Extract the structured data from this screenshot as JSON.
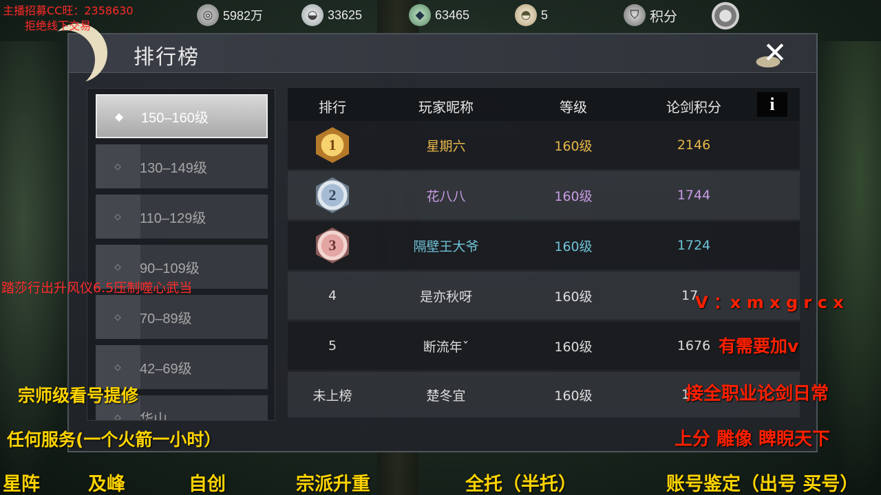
{
  "overlay": {
    "top_left_line1": "主播招募CC旺：2358630",
    "top_left_line2": "拒绝线下交易",
    "mid_left_red": "踏莎行出升风仪6.5压制噬心武当",
    "left_yellow_1": "宗师级看号提修",
    "left_yellow_2": "任何服务(一个火箭一小时）",
    "right_contact": "V ：x m x g r c x",
    "right_line_1": "有需要加v",
    "right_line_2": "接全职业论剑日常",
    "right_line_3": "上分   雕像  睥睨天下",
    "bottom_menu": [
      "星阵",
      "及峰",
      "自创",
      "宗派升重",
      "全托（半托）",
      "账号鉴定（出号 买号）"
    ]
  },
  "resources": [
    {
      "icon": "coin-icon",
      "value": "5982万"
    },
    {
      "icon": "silver-ingot-icon",
      "value": "33625"
    },
    {
      "icon": "jade-icon",
      "value": "63465"
    },
    {
      "icon": "gold-ingot-icon",
      "value": "5"
    },
    {
      "icon": "score-badge-icon",
      "value": "积分"
    }
  ],
  "panel": {
    "title": "排行榜",
    "close_glyph": "✕"
  },
  "tiers": [
    {
      "label": "150–160级",
      "active": true
    },
    {
      "label": "130–149级",
      "active": false
    },
    {
      "label": "110–129级",
      "active": false
    },
    {
      "label": "90–109级",
      "active": false
    },
    {
      "label": "70–89级",
      "active": false
    },
    {
      "label": "42–69级",
      "active": false
    },
    {
      "label": "华山",
      "active": false
    }
  ],
  "table": {
    "headers": {
      "rank": "排行",
      "name": "玩家昵称",
      "level": "等级",
      "score": "论剑积分"
    },
    "info_glyph": "i",
    "rows": [
      {
        "rank": "1",
        "name": "星期六",
        "level": "160级",
        "score": "2146",
        "color": "#e8b84a"
      },
      {
        "rank": "2",
        "name": "花八八",
        "level": "160级",
        "score": "1744",
        "color": "#c89be6"
      },
      {
        "rank": "3",
        "name": "隔壁王大爷",
        "level": "160级",
        "score": "1724",
        "color": "#6fc3d8"
      },
      {
        "rank": "4",
        "name": "是亦秋呀",
        "level": "160级",
        "score": "17",
        "color": "#dddddd"
      },
      {
        "rank": "5",
        "name": "断流年ˇ",
        "level": "160级",
        "score": "1676",
        "color": "#dddddd"
      },
      {
        "rank": "未上榜",
        "name": "楚冬宜",
        "level": "160级",
        "score": "1",
        "color": "#dddddd"
      }
    ]
  }
}
